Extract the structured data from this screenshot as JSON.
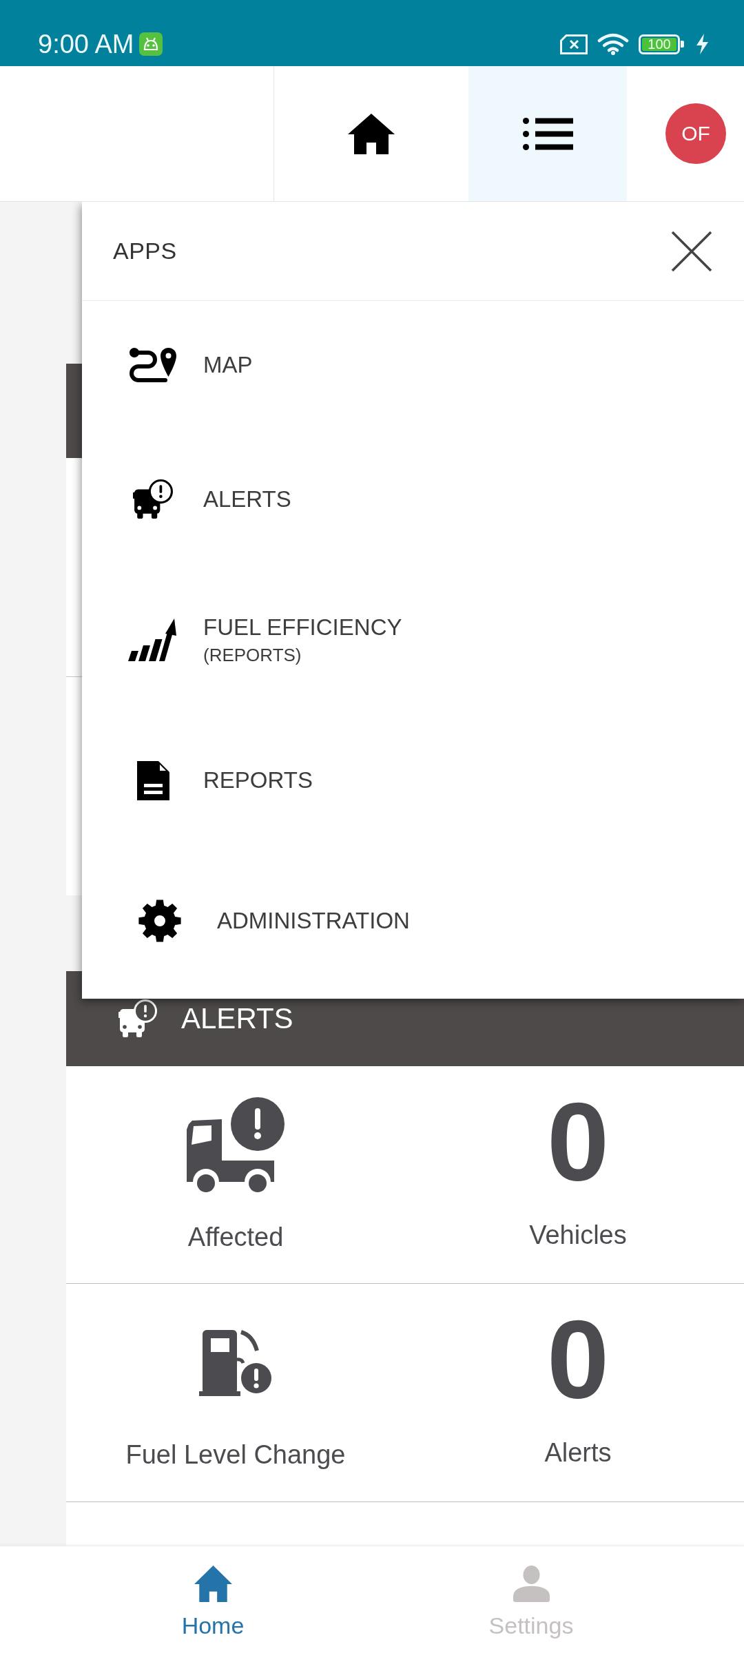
{
  "status_bar": {
    "time": "9:00 AM",
    "battery": "100"
  },
  "header": {
    "tabs": [
      {
        "kind": "home",
        "selected": false
      },
      {
        "kind": "apps",
        "selected": true
      }
    ],
    "avatar": {
      "initials": "OF"
    }
  },
  "apps_menu": {
    "title": "APPS",
    "items": [
      {
        "kind": "map",
        "label": "MAP"
      },
      {
        "kind": "alerts",
        "label": "ALERTS"
      },
      {
        "kind": "fuel",
        "label": "FUEL EFFICIENCY",
        "sublabel": "(REPORTS)"
      },
      {
        "kind": "reports",
        "label": "REPORTS"
      },
      {
        "kind": "admin",
        "label": "ADMINISTRATION"
      }
    ]
  },
  "alerts_section": {
    "title": "ALERTS",
    "stats": [
      {
        "kind": "vehicles",
        "label": "Affected",
        "value": "0",
        "unit": "Vehicles"
      },
      {
        "kind": "fuel",
        "label": "Fuel Level Change",
        "value": "0",
        "unit": "Alerts"
      }
    ]
  },
  "bottom_nav": [
    {
      "kind": "home",
      "label": "Home",
      "selected": true
    },
    {
      "kind": "settings",
      "label": "Settings",
      "selected": false
    }
  ]
}
